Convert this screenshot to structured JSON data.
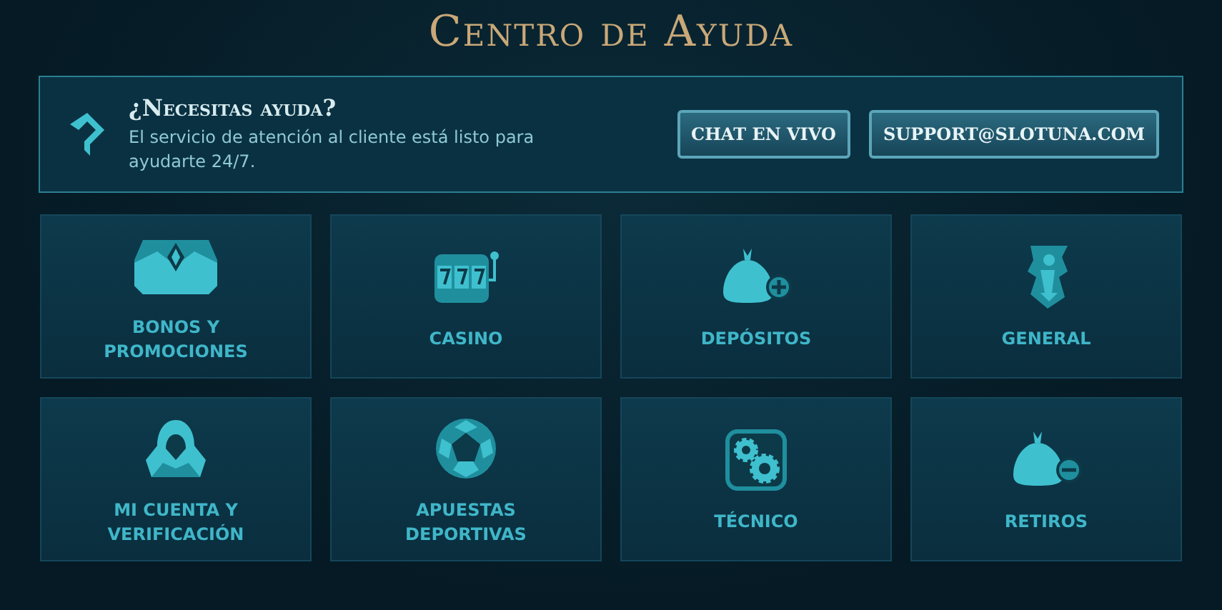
{
  "title": "Centro de Ayuda",
  "banner": {
    "heading": "¿Necesitas ayuda?",
    "text": "El servicio de atención al cliente está listo para ayudarte 24/7.",
    "buttons": [
      "CHAT EN VIVO",
      "SUPPORT@SLOTUNA.COM"
    ]
  },
  "categories": [
    {
      "label": "BONOS Y PROMOCIONES",
      "kind": "chest"
    },
    {
      "label": "CASINO",
      "kind": "slot"
    },
    {
      "label": "DEPÓSITOS",
      "kind": "bag-plus"
    },
    {
      "label": "GENERAL",
      "kind": "info"
    },
    {
      "label": "MI CUENTA Y VERIFICACIÓN",
      "kind": "hood"
    },
    {
      "label": "APUESTAS DEPORTIVAS",
      "kind": "ball"
    },
    {
      "label": "TÉCNICO",
      "kind": "gears"
    },
    {
      "label": "RETIROS",
      "kind": "bag-minus"
    }
  ]
}
